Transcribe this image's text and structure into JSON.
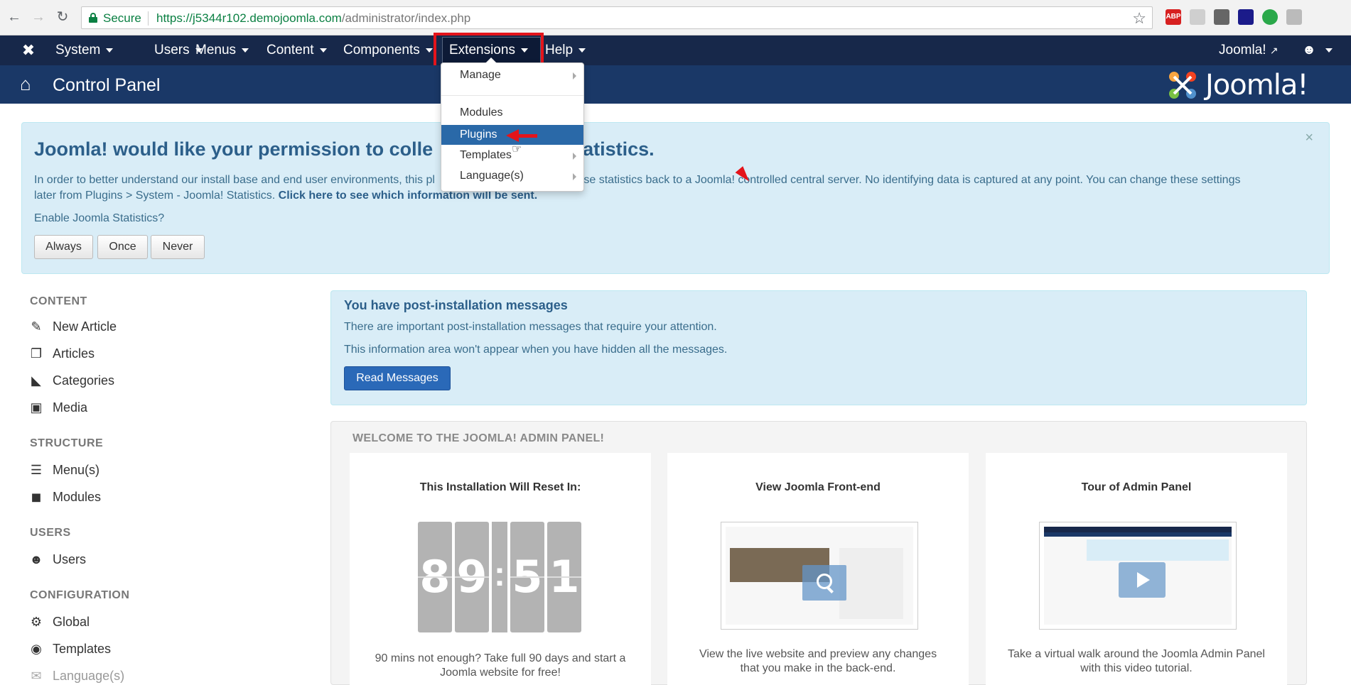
{
  "browser": {
    "secure_label": "Secure",
    "url_scheme": "https://",
    "url_host": "j5344r102.demojoomla.com",
    "url_path": "/administrator/index.php",
    "extension_icons": [
      "ABP",
      "",
      "",
      "",
      "",
      ""
    ]
  },
  "topnav": {
    "items": [
      {
        "label": "System"
      },
      {
        "label": "Users"
      },
      {
        "label": "Menus"
      },
      {
        "label": "Content"
      },
      {
        "label": "Components"
      },
      {
        "label": "Extensions"
      },
      {
        "label": "Help"
      }
    ],
    "site_link": "Joomla!"
  },
  "extensions_menu": {
    "items": [
      {
        "label": "Manage",
        "has_submenu": true
      },
      {
        "label": "Modules",
        "has_submenu": false
      },
      {
        "label": "Plugins",
        "has_submenu": false,
        "active": true
      },
      {
        "label": "Templates",
        "has_submenu": true
      },
      {
        "label": "Language(s)",
        "has_submenu": true
      }
    ]
  },
  "header": {
    "title": "Control Panel",
    "brand": "Joomla!"
  },
  "stats_alert": {
    "title_left": "Joomla! would like your permission to colle",
    "title_right": "statistics.",
    "body_left": "In order to better understand our install base and end user environments, this pl",
    "body_right": "nd those statistics back to a Joomla! controlled central server. No identifying data is captured at any point. You can change these settings",
    "body_line2": "later from Plugins > System - Joomla! Statistics.",
    "body_link": "Click here to see which information will be sent.",
    "question": "Enable Joomla Statistics?",
    "buttons": [
      "Always",
      "Once",
      "Never"
    ]
  },
  "sidebar": {
    "sections": [
      {
        "heading": "CONTENT",
        "items": [
          {
            "label": "New Article",
            "icon": "pencil-icon"
          },
          {
            "label": "Articles",
            "icon": "copy-icon"
          },
          {
            "label": "Categories",
            "icon": "folder-icon"
          },
          {
            "label": "Media",
            "icon": "image-icon"
          }
        ]
      },
      {
        "heading": "STRUCTURE",
        "items": [
          {
            "label": "Menu(s)",
            "icon": "list-icon"
          },
          {
            "label": "Modules",
            "icon": "cube-icon"
          }
        ]
      },
      {
        "heading": "USERS",
        "items": [
          {
            "label": "Users",
            "icon": "user-icon"
          }
        ]
      },
      {
        "heading": "CONFIGURATION",
        "items": [
          {
            "label": "Global",
            "icon": "gear-icon"
          },
          {
            "label": "Templates",
            "icon": "eye-icon"
          },
          {
            "label": "Language(s)",
            "icon": "comment-icon"
          }
        ]
      }
    ]
  },
  "post_install": {
    "title": "You have post-installation messages",
    "line1": "There are important post-installation messages that require your attention.",
    "line2": "This information area won't appear when you have hidden all the messages.",
    "button": "Read Messages"
  },
  "welcome": {
    "title": "WELCOME TO THE JOOMLA! ADMIN PANEL!",
    "cards": [
      {
        "title": "This Installation Will Reset In:",
        "text": "90 mins not enough? Take full 90 days and start a Joomla website for free!"
      },
      {
        "title": "View Joomla Front-end",
        "text": "View the live website and preview any changes that you make in the back-end."
      },
      {
        "title": "Tour of Admin Panel",
        "text": "Take a virtual walk around the Joomla Admin Panel with this video tutorial."
      }
    ],
    "countdown": {
      "digits": [
        "8",
        "9",
        "5",
        "1"
      ],
      "separator": ":"
    }
  },
  "colors": {
    "topnav_bg": "#17284a",
    "header_bg": "#1a3867",
    "alert_bg": "#d9edf7",
    "primary_button": "#2a69b8",
    "highlight_red": "#e4141b"
  }
}
